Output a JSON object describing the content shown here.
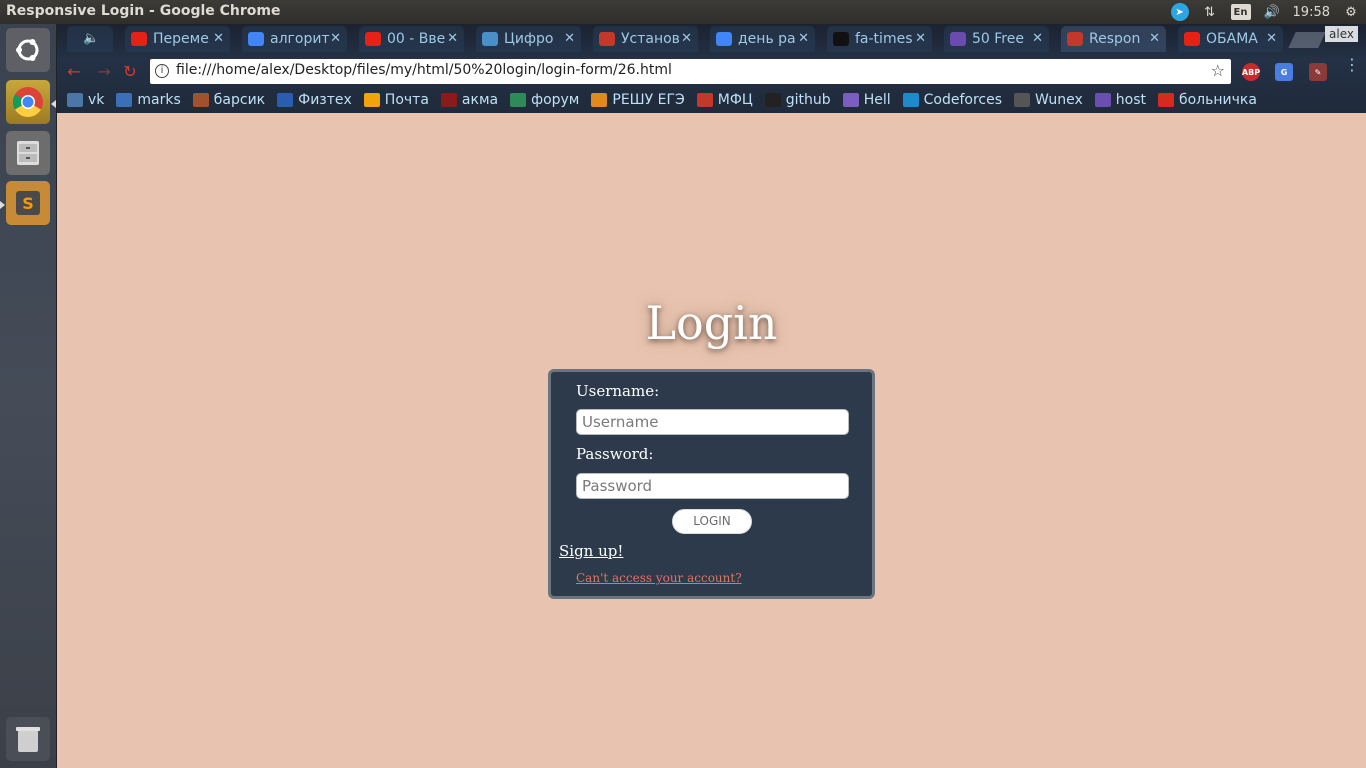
{
  "window": {
    "title": "Responsive Login - Google Chrome"
  },
  "tray": {
    "lang": "En",
    "clock": "19:58",
    "user": "alex"
  },
  "tabs": [
    {
      "label": "Переме",
      "color": "#e62117"
    },
    {
      "label": "алгорит",
      "color": "#4285f4"
    },
    {
      "label": "00 - Вве",
      "color": "#e62117"
    },
    {
      "label": "Цифро",
      "color": "#4a90c8"
    },
    {
      "label": "Установ",
      "color": "#c0392b"
    },
    {
      "label": "день ра",
      "color": "#4285f4"
    },
    {
      "label": "fa-times",
      "color": "#111111"
    },
    {
      "label": "50 Free",
      "color": "#6b4bb0"
    },
    {
      "label": "Respon",
      "color": "#c0392b"
    },
    {
      "label": "ОБАМА",
      "color": "#e62117"
    }
  ],
  "address": {
    "url": "file:///home/alex/Desktop/files/my/html/50%20login/login-form/26.html"
  },
  "extensions": {
    "abp": "ABP"
  },
  "bookmarks": [
    {
      "label": "vk",
      "color": "#4a76a8"
    },
    {
      "label": "marks",
      "color": "#3b6fb6"
    },
    {
      "label": "барсик",
      "color": "#a0522d"
    },
    {
      "label": "Физтех",
      "color": "#2a5db0"
    },
    {
      "label": "Почта",
      "color": "#f0a30a"
    },
    {
      "label": "акма",
      "color": "#8b1a1a"
    },
    {
      "label": "форум",
      "color": "#2e8b57"
    },
    {
      "label": "РЕШУ ЕГЭ",
      "color": "#e08a1e"
    },
    {
      "label": "МФЦ",
      "color": "#c0392b"
    },
    {
      "label": "github",
      "color": "#222222"
    },
    {
      "label": "Hell",
      "color": "#7a5fc0"
    },
    {
      "label": "Codeforces",
      "color": "#1f8acb"
    },
    {
      "label": "Wunex",
      "color": "#555555"
    },
    {
      "label": "host",
      "color": "#6a4fb0"
    },
    {
      "label": "больничка",
      "color": "#d52b1e"
    }
  ],
  "page": {
    "title": "Login",
    "username_label": "Username:",
    "username_placeholder": "Username",
    "password_label": "Password:",
    "password_placeholder": "Password",
    "login_button": "LOGIN",
    "signup_link": "Sign up!",
    "cant_access_link": "Can't access your account?"
  }
}
